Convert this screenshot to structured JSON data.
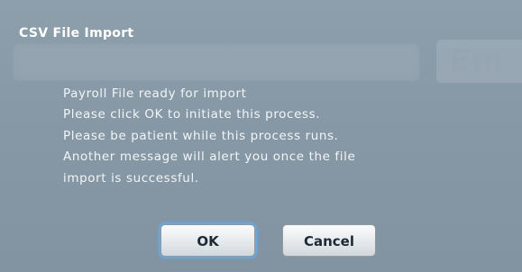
{
  "dialog": {
    "title": "CSV File Import",
    "background_ghost_text": "Em",
    "message_lines": [
      "Payroll File ready for import",
      "Please click OK to initiate this process.",
      "Please be patient while this process runs.",
      "Another message will alert you once the file",
      "import is successful."
    ],
    "buttons": {
      "ok_label": "OK",
      "cancel_label": "Cancel"
    }
  },
  "colors": {
    "dialog_background": "#8799a6",
    "text": "#f2f5f7",
    "title_text": "#ffffff",
    "button_text": "#1e2a33",
    "focus_ring": "#6aa7d8"
  }
}
